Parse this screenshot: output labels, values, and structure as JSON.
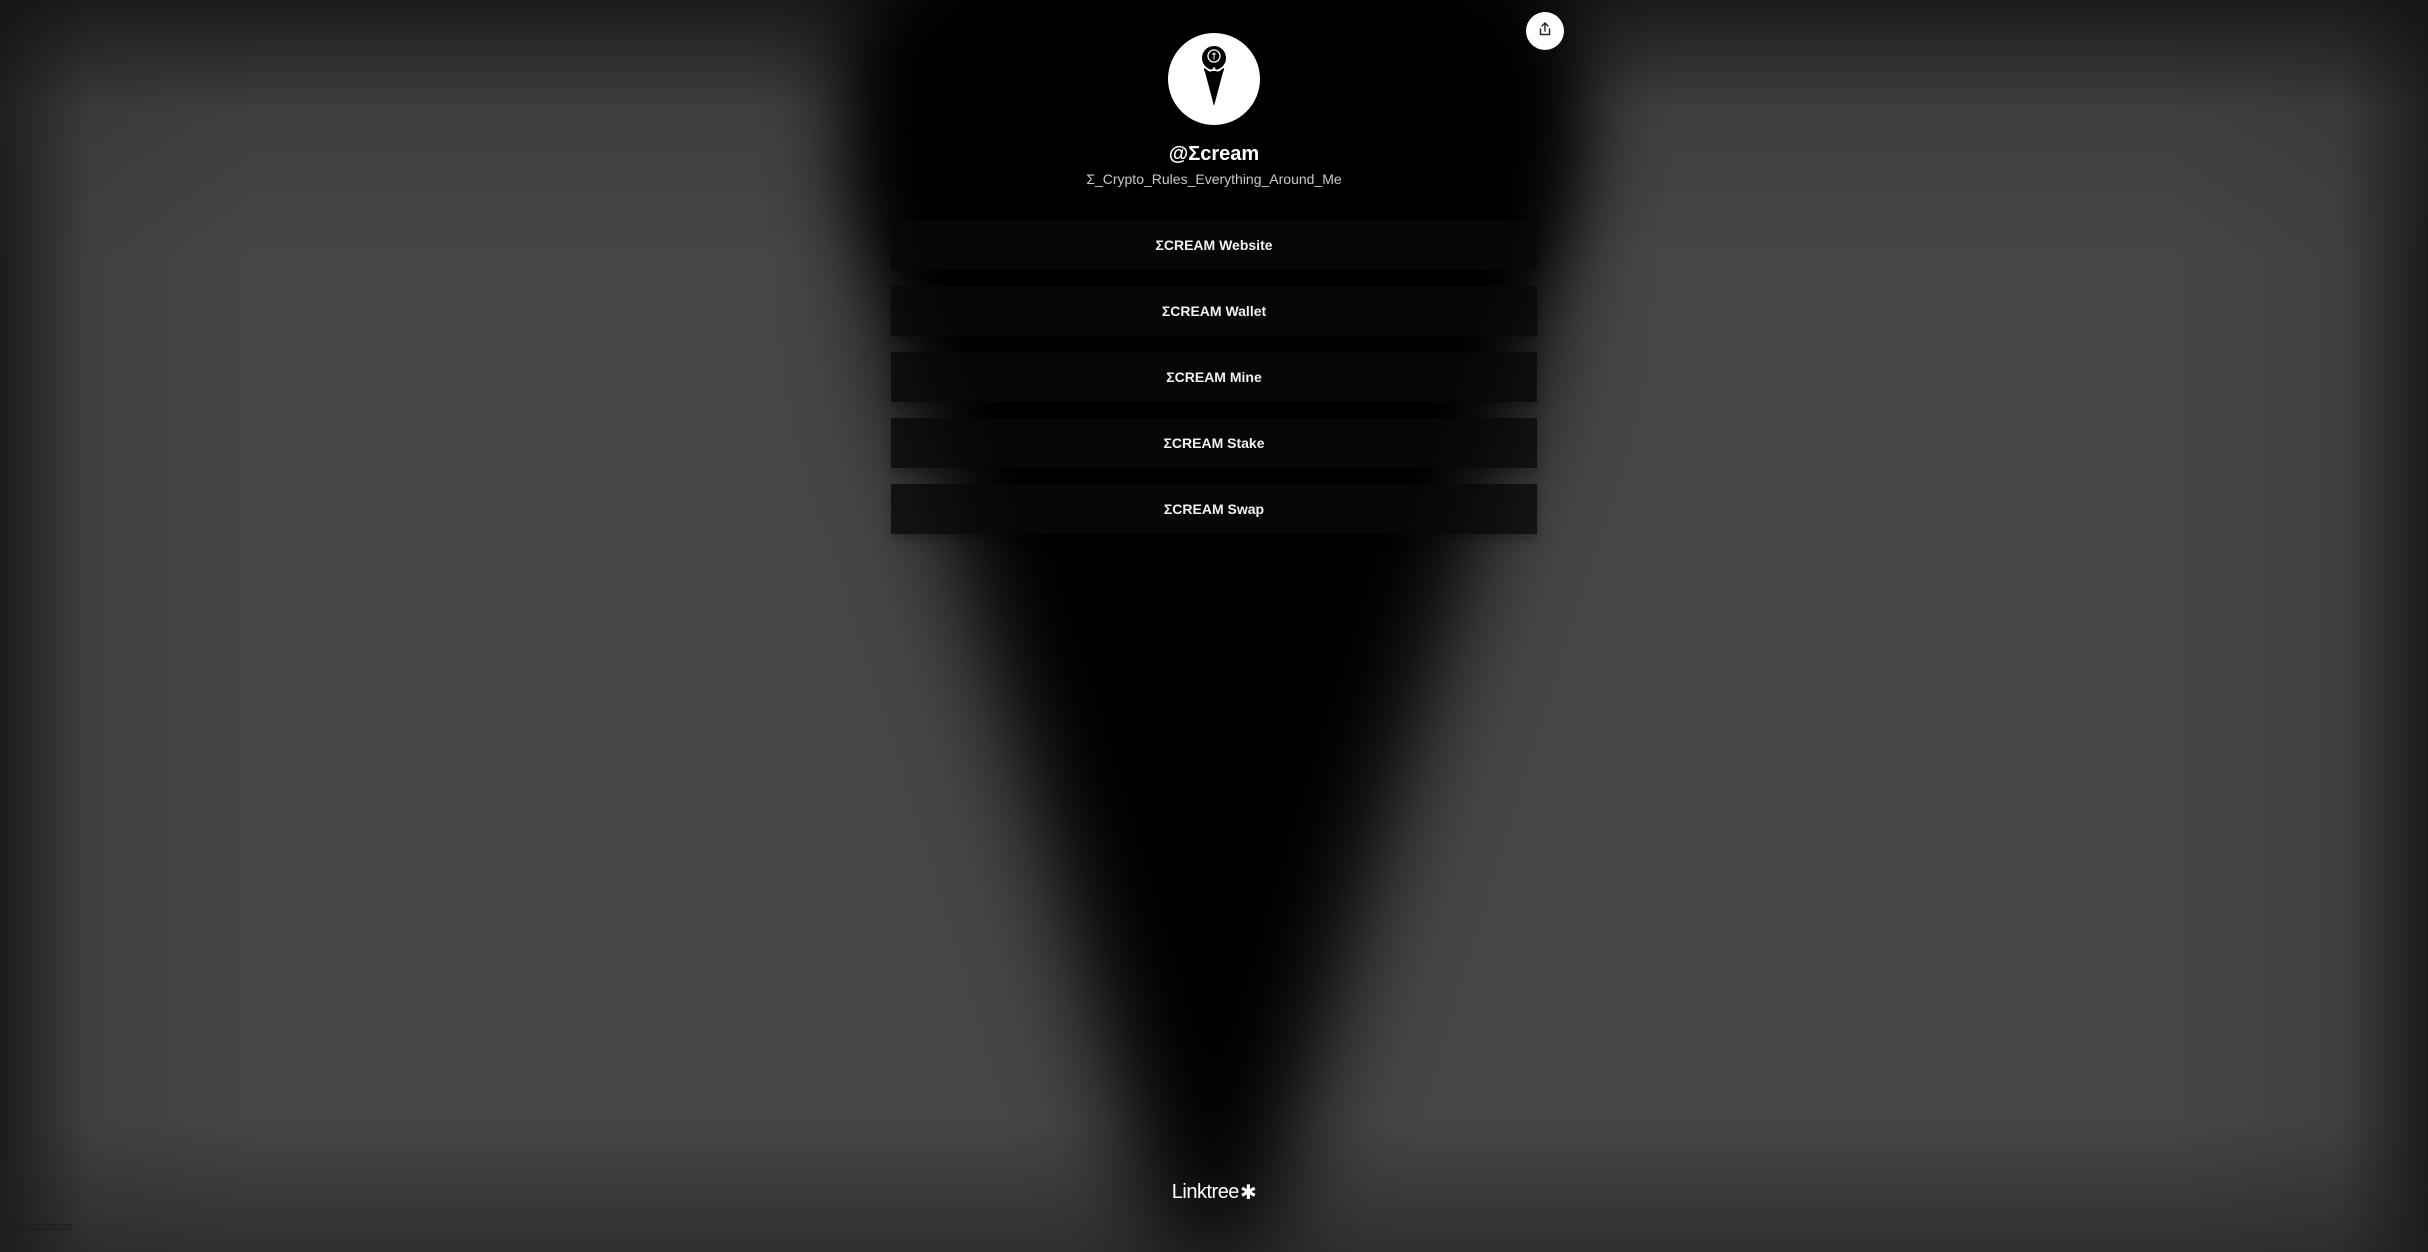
{
  "profile": {
    "handle": "@Σcream",
    "bio": "Σ_Crypto_Rules_Everything_Around_Me",
    "avatar_icon": "ice-cream-cone-icon"
  },
  "share": {
    "icon": "share-icon"
  },
  "links": [
    {
      "label": "ΣCREAM Website"
    },
    {
      "label": "ΣCREAM Wallet"
    },
    {
      "label": "ΣCREAM Mine"
    },
    {
      "label": "ΣCREAM Stake"
    },
    {
      "label": "ΣCREAM Swap"
    }
  ],
  "footer": {
    "logo_text": "Linktree",
    "logo_mark": "✱",
    "cookie_label": "Cookie Preferences"
  },
  "colors": {
    "background": "#464646",
    "cone": "#000000",
    "button_bg": "#080808",
    "text": "#ffffff"
  }
}
